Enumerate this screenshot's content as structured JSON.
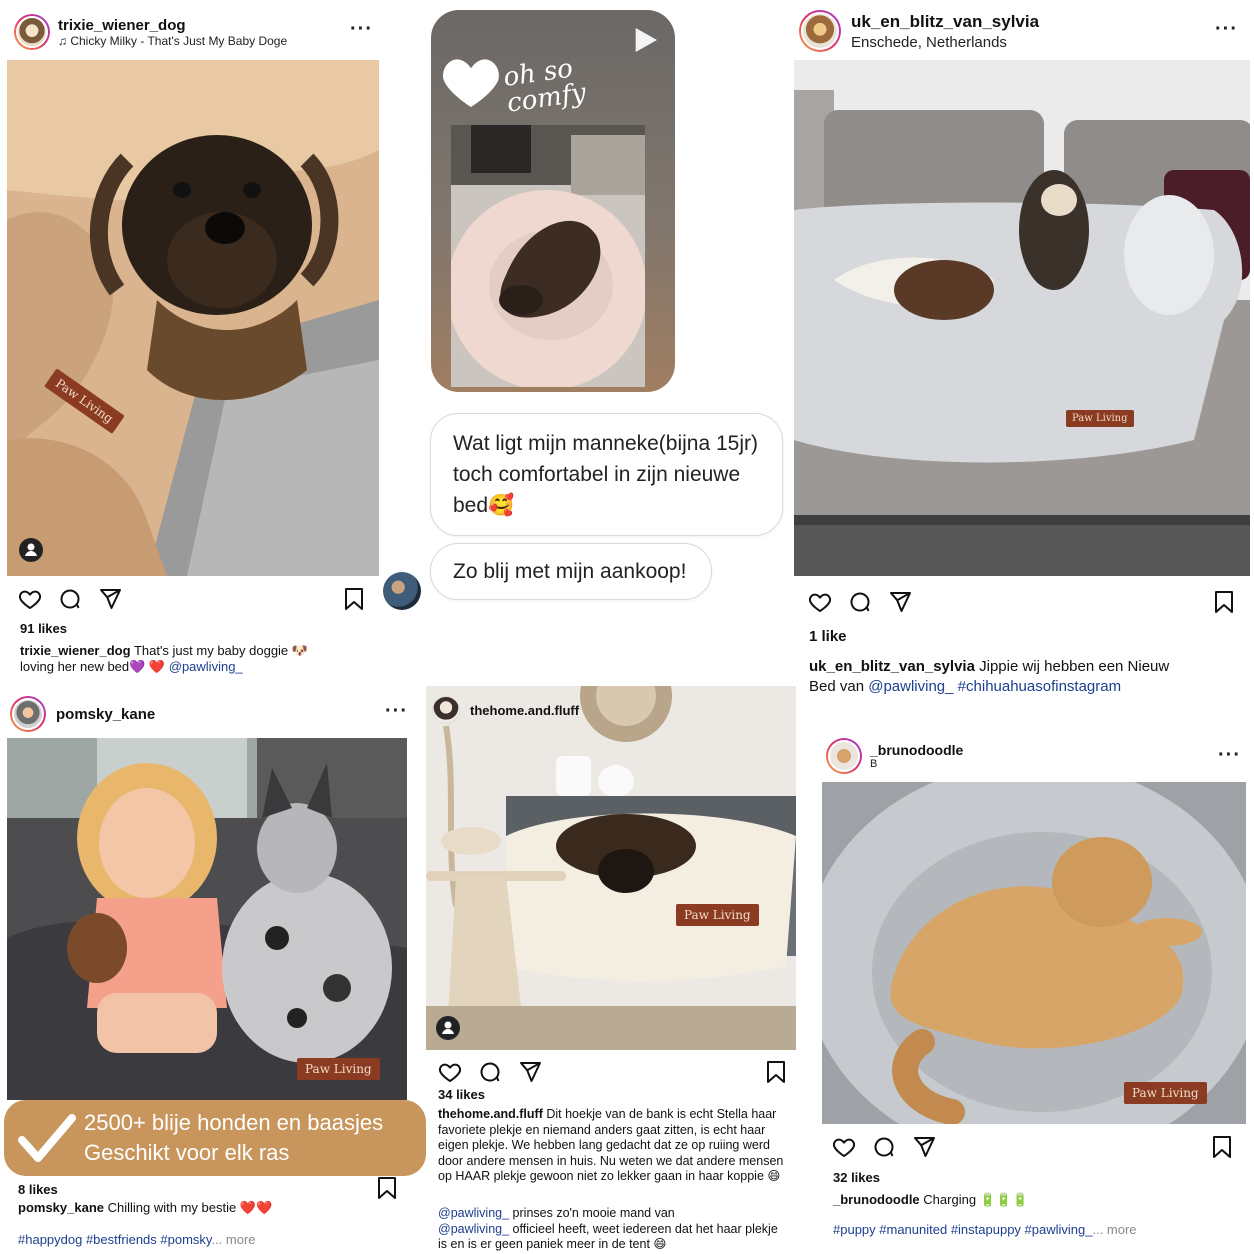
{
  "post1": {
    "username": "trixie_wiener_dog",
    "audio": "Chicky Milky - That's Just My Baby Doge",
    "likes": "91 likes",
    "caption_user": "trixie_wiener_dog",
    "caption_text": "That's just my baby doggie 🐶",
    "caption_line2": "loving her new bed💜 ❤️",
    "caption_mention": "@pawliving_",
    "paw_label": "Paw Living"
  },
  "story": {
    "sticker_text": "oh so comfy",
    "message1": "Wat ligt mijn manneke(bijna 15jr) toch comfortabel in zijn nieuwe bed🥰",
    "message2": "Zo blij met mijn aankoop!"
  },
  "post2": {
    "username": "uk_en_blitz_van_sylvia",
    "location": "Enschede, Netherlands",
    "likes": "1 like",
    "caption_user": "uk_en_blitz_van_sylvia",
    "caption_text": "Jippie wij hebben een Nieuw",
    "caption_line2": "Bed van",
    "caption_mention": "@pawliving_",
    "caption_hashtag": "#chihuahuasofinstagram",
    "paw_label": "Paw Living"
  },
  "post3": {
    "username": "pomsky_kane",
    "likes": "8 likes",
    "caption_user": "pomsky_kane",
    "caption_text": "Chilling with my bestie ❤️❤️",
    "hashtags": "#happydog #bestfriends #pomsky",
    "more": "... more",
    "paw_label": "Paw Living"
  },
  "banner": {
    "line1": "2500+ blije honden en baasjes",
    "line2": "Geschikt voor elk ras"
  },
  "post4": {
    "username": "thehome.and.fluff",
    "likes": "34 likes",
    "caption_user": "thehome.and.fluff",
    "caption_text": "Dit hoekje van de bank is echt Stella haar favoriete plekje en niemand anders gaat zitten, is echt haar eigen plekje. We hebben lang gedacht dat ze op ruiing werd door andere mensen in huis. Nu weten we dat andere mensen op HAAR plekje gewoon niet zo lekker gaan in haar koppie 😄",
    "comment1_mention": "@pawliving_",
    "comment1_text": "prinses zo'n mooie mand van",
    "comment2_mention": "@pawliving_",
    "comment2_text": "officieel heeft, weet iedereen dat het haar plekje is en is er geen paniek meer in de tent 😄",
    "paw_label": "Paw Living"
  },
  "post5": {
    "username": "_brunodoodle",
    "subline": "B",
    "likes": "32 likes",
    "caption_user": "_brunodoodle",
    "caption_text": "Charging 🔋🔋🔋",
    "hashtags": "#puppy #manunited #instapuppy #pawliving_",
    "more": "... more",
    "paw_label": "Paw Living"
  },
  "colors": {
    "accent_link": "#1d3f8f",
    "banner_bg": "#c8955c",
    "paw_label_bg": "#8a3b22"
  },
  "icons": [
    "heart-icon",
    "comment-icon",
    "share-icon",
    "bookmark-icon",
    "more-icon",
    "play-icon",
    "check-icon",
    "person-icon",
    "music-icon"
  ]
}
